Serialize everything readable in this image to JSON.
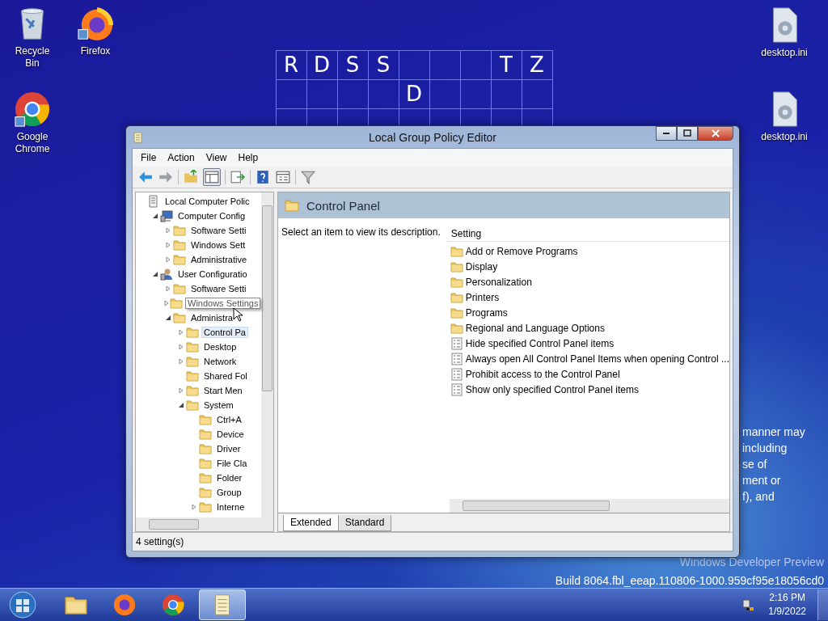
{
  "desktop": {
    "icons": [
      {
        "label": "Recycle Bin",
        "kind": "recycle"
      },
      {
        "label": "Firefox",
        "kind": "firefox"
      },
      {
        "label": "desktop.ini",
        "kind": "settings-file"
      },
      {
        "label": "Google Chrome",
        "kind": "chrome"
      },
      {
        "label": "desktop.ini",
        "kind": "settings-file"
      }
    ],
    "wallpaper_letters": [
      [
        "R",
        "D",
        "S",
        "S",
        "T",
        "Z"
      ],
      [
        "D"
      ]
    ],
    "wallpaper_text": [
      "manner may",
      "including",
      "se of",
      "ment or",
      "f), and"
    ],
    "build_info": [
      "Windows Developer Preview",
      "Build 8064.fbl_eeap.110806-1000.959cf95e18056cd0"
    ]
  },
  "window": {
    "title": "Local Group Policy Editor",
    "menu": [
      "File",
      "Action",
      "View",
      "Help"
    ],
    "tree": [
      {
        "label": "Local Computer Polic",
        "kind": "policy",
        "selected": false,
        "children": [
          {
            "label": "Computer Config",
            "kind": "computer",
            "expanded": true,
            "selected": false,
            "children": [
              {
                "label": "Software Setti",
                "kind": "folder",
                "expanded": false,
                "selected": false
              },
              {
                "label": "Windows Sett",
                "kind": "folder",
                "expanded": false,
                "selected": false
              },
              {
                "label": "Administrative",
                "kind": "folder",
                "expanded": false,
                "selected": false
              }
            ]
          },
          {
            "label": "User Configuratio",
            "kind": "user",
            "expanded": true,
            "selected": false,
            "children": [
              {
                "label": "Software Setti",
                "kind": "folder",
                "expanded": false,
                "selected": false
              },
              {
                "label": "Windows Settings",
                "kind": "folder",
                "expanded": false,
                "selected": false,
                "tooltip": true
              },
              {
                "label": "Administra",
                "kind": "folder",
                "expanded": true,
                "selected": false,
                "children": [
                  {
                    "label": "Control Pa",
                    "kind": "folder",
                    "expanded": false,
                    "selected": true
                  },
                  {
                    "label": "Desktop",
                    "kind": "folder",
                    "expanded": false,
                    "selected": false
                  },
                  {
                    "label": "Network",
                    "kind": "folder",
                    "expanded": false,
                    "selected": false
                  },
                  {
                    "label": "Shared Fol",
                    "kind": "folder",
                    "selected": false
                  },
                  {
                    "label": "Start Men",
                    "kind": "folder",
                    "expanded": false,
                    "selected": false
                  },
                  {
                    "label": "System",
                    "kind": "folder",
                    "expanded": true,
                    "selected": false,
                    "children": [
                      {
                        "label": "Ctrl+A",
                        "kind": "folder",
                        "selected": false
                      },
                      {
                        "label": "Device",
                        "kind": "folder",
                        "selected": false
                      },
                      {
                        "label": "Driver",
                        "kind": "folder",
                        "selected": false
                      },
                      {
                        "label": "File Cla",
                        "kind": "folder",
                        "selected": false
                      },
                      {
                        "label": "Folder",
                        "kind": "folder",
                        "selected": false
                      },
                      {
                        "label": "Group",
                        "kind": "folder",
                        "selected": false
                      },
                      {
                        "label": "Interne",
                        "kind": "folder",
                        "expanded": false,
                        "selected": false
                      }
                    ]
                  }
                ]
              }
            ]
          }
        ]
      }
    ],
    "header": "Control Panel",
    "description": "Select an item to view its description.",
    "column": "Setting",
    "settings": [
      {
        "label": "Add or Remove Programs",
        "kind": "folder"
      },
      {
        "label": "Display",
        "kind": "folder"
      },
      {
        "label": "Personalization",
        "kind": "folder"
      },
      {
        "label": "Printers",
        "kind": "folder"
      },
      {
        "label": "Programs",
        "kind": "folder"
      },
      {
        "label": "Regional and Language Options",
        "kind": "folder"
      },
      {
        "label": "Hide specified Control Panel items",
        "kind": "policy"
      },
      {
        "label": "Always open All Control Panel Items when opening Control ...",
        "kind": "policy"
      },
      {
        "label": "Prohibit access to the Control Panel",
        "kind": "policy"
      },
      {
        "label": "Show only specified Control Panel items",
        "kind": "policy"
      }
    ],
    "tabs": [
      {
        "label": "Extended",
        "selected": true
      },
      {
        "label": "Standard",
        "selected": false
      }
    ],
    "status_bar": "4 setting(s)"
  },
  "taskbar": {
    "apps": [
      {
        "kind": "explorer",
        "selected": false
      },
      {
        "kind": "firefox",
        "selected": false
      },
      {
        "kind": "chrome",
        "selected": false
      },
      {
        "kind": "policy",
        "selected": true
      }
    ],
    "time": "2:16 PM",
    "date": "1/9/2022"
  }
}
